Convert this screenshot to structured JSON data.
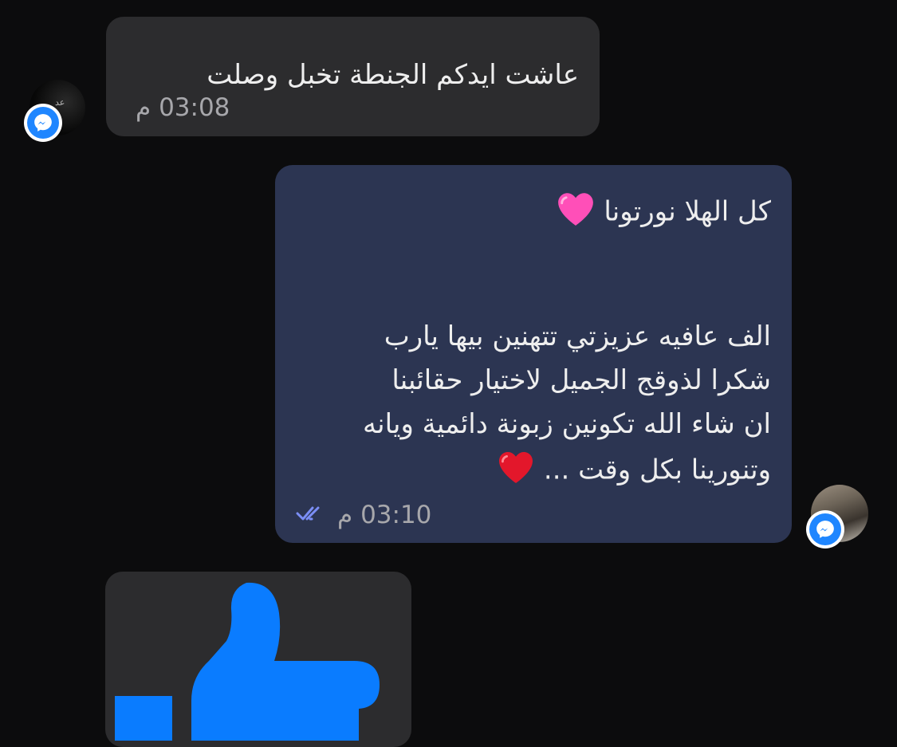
{
  "messages": [
    {
      "direction": "incoming",
      "lines": [
        "عاشت ايدكم الجنطة تخبل  وصلت"
      ],
      "time": "03:08 م"
    },
    {
      "direction": "outgoing",
      "lines": [
        "كل الهلا نورتونا",
        "الف عافيه عزيزتي تتهنين بيها يارب",
        "شكرا لذوقج الجميل لاختيار حقائبنا",
        "ان شاء الله تكونين زبونة دائمية ويانه",
        "وتنورينا بكل وقت ..."
      ],
      "emojis": [
        "pink-heart",
        "red-heart"
      ],
      "time": "03:10 م",
      "status": "read"
    },
    {
      "direction": "incoming",
      "type": "like-sticker",
      "icon": "thumbs-up-icon"
    }
  ],
  "colors": {
    "background": "#0c0c0d",
    "incoming_bubble": "#2c2c2e",
    "outgoing_bubble": "#2c3552",
    "messenger_blue": "#1f86ff",
    "like_blue": "#0a7cff",
    "read_ticks": "#7b8ef5"
  }
}
